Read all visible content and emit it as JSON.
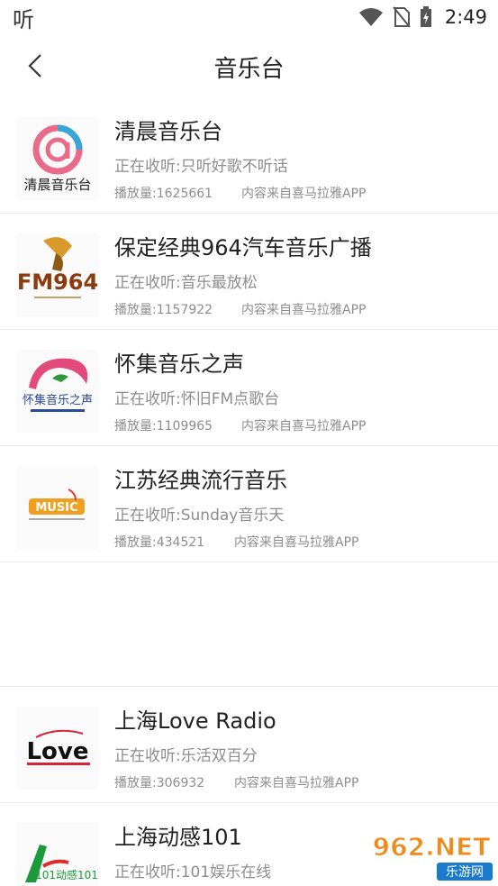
{
  "status_bar": {
    "app_glyph": "听",
    "time": "2:49",
    "icons": [
      "wifi-icon",
      "no-sim-icon",
      "battery-charging-icon"
    ]
  },
  "header": {
    "back_icon": "chevron-left-icon",
    "title": "音乐台"
  },
  "stations": [
    {
      "name": "清晨音乐台",
      "now_playing": "正在收听:只听好歌不听话",
      "plays": "播放量:1625661",
      "source": "内容来自喜马拉雅APP",
      "logo_text": "清晨音乐台"
    },
    {
      "name": "保定经典964汽车音乐广播",
      "now_playing": "正在收听:音乐最放松",
      "plays": "播放量:1157922",
      "source": "内容来自喜马拉雅APP",
      "logo_text": "FM964"
    },
    {
      "name": "怀集音乐之声",
      "now_playing": "正在收听:怀旧FM点歌台",
      "plays": "播放量:1109965",
      "source": "内容来自喜马拉雅APP",
      "logo_text": "怀集音乐之声"
    },
    {
      "name": "江苏经典流行音乐",
      "now_playing": "正在收听:Sunday音乐天",
      "plays": "播放量:434521",
      "source": "内容来自喜马拉雅APP",
      "logo_text": "MUSIC"
    },
    {
      "name": "上海Love Radio",
      "now_playing": "正在收听:乐活双百分",
      "plays": "播放量:306932",
      "source": "内容来自喜马拉雅APP",
      "logo_text": "Love"
    },
    {
      "name": "上海动感101",
      "now_playing": "正在收听:101娱乐在线",
      "plays": "",
      "source": "",
      "logo_text": "101动感101"
    }
  ],
  "watermark": {
    "text": "962.NET",
    "subtext": "乐游网"
  },
  "colors": {
    "title": "#222222",
    "secondary": "#8d8d8d",
    "divider": "#e8e8e8"
  }
}
